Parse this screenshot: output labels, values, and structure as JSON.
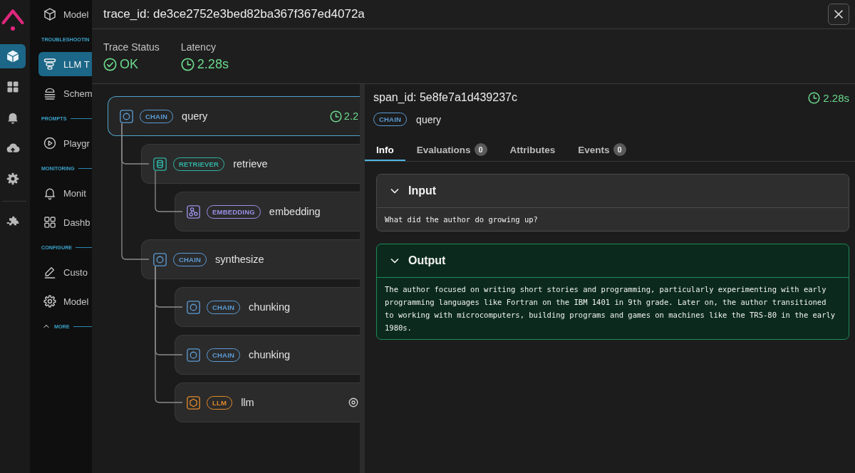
{
  "rail": {
    "top": [
      {
        "selected": true
      },
      {
        "selected": false
      },
      {
        "selected": false
      },
      {
        "selected": false
      },
      {
        "selected": false
      }
    ],
    "bottom": [
      {
        "selected": false
      }
    ]
  },
  "nav": {
    "items_top": [
      {
        "label": "Model",
        "selected": false
      }
    ],
    "sections": [
      {
        "heading": "TROUBLESHOOTIN",
        "items": [
          {
            "label": "LLM T",
            "selected": true
          },
          {
            "label": "Schem",
            "selected": false
          }
        ]
      },
      {
        "heading": "PROMPTS",
        "items": [
          {
            "label": "Playgr",
            "selected": false
          }
        ]
      },
      {
        "heading": "MONITORING",
        "items": [
          {
            "label": "Monit",
            "selected": false
          },
          {
            "label": "Dashb",
            "selected": false
          }
        ]
      },
      {
        "heading": "CONFIGURE",
        "items": [
          {
            "label": "Custo",
            "selected": false
          },
          {
            "label": "Model",
            "selected": false
          }
        ]
      }
    ],
    "more": {
      "label": "MORE",
      "expanded": true
    }
  },
  "modal": {
    "title": "trace_id: de3ce2752e3bed82ba367f367ed4072a"
  },
  "stats": [
    {
      "kind": "status",
      "label": "Trace Status",
      "value": "OK"
    },
    {
      "kind": "latency",
      "label": "Latency",
      "value": "2.28s"
    }
  ],
  "trace_tree": [
    {
      "kind": "chain",
      "badge": "CHAIN",
      "name": "query",
      "latency": "2.2",
      "selected": true,
      "children": [
        {
          "kind": "retriever",
          "badge": "RETRIEVER",
          "name": "retrieve",
          "selected": false,
          "children": [
            {
              "kind": "embedding",
              "badge": "EMBEDDING",
              "name": "embedding",
              "selected": false
            }
          ]
        },
        {
          "kind": "chain",
          "badge": "CHAIN",
          "name": "synthesize",
          "selected": false,
          "children": [
            {
              "kind": "chain",
              "badge": "CHAIN",
              "name": "chunking",
              "selected": false
            },
            {
              "kind": "chain",
              "badge": "CHAIN",
              "name": "chunking",
              "selected": false
            },
            {
              "kind": "llm",
              "badge": "LLM",
              "name": "llm",
              "selected": false
            }
          ]
        }
      ]
    }
  ],
  "span_detail": {
    "title": "span_id: 5e8fe7a1d439237c",
    "latency": "2.28s",
    "kind": "chain",
    "badge": "CHAIN",
    "name": "query"
  },
  "tabs": [
    {
      "label": "Info",
      "selected": true
    },
    {
      "label": "Evaluations",
      "count": "0",
      "selected": false
    },
    {
      "label": "Attributes",
      "selected": false
    },
    {
      "label": "Events",
      "count": "0",
      "selected": false
    }
  ],
  "sections": [
    {
      "kind": "input",
      "title": "Input",
      "expanded": true,
      "body": "What did the author do growing up?"
    },
    {
      "kind": "output",
      "title": "Output",
      "expanded": true,
      "body": "The author focused on writing short stories and programming, particularly experimenting with early programming languages like Fortran on the IBM 1401 in 9th grade. Later on, the author transitioned to working with microcomputers, building programs and games on machines like the TRS-80 in the early 1980s."
    }
  ]
}
